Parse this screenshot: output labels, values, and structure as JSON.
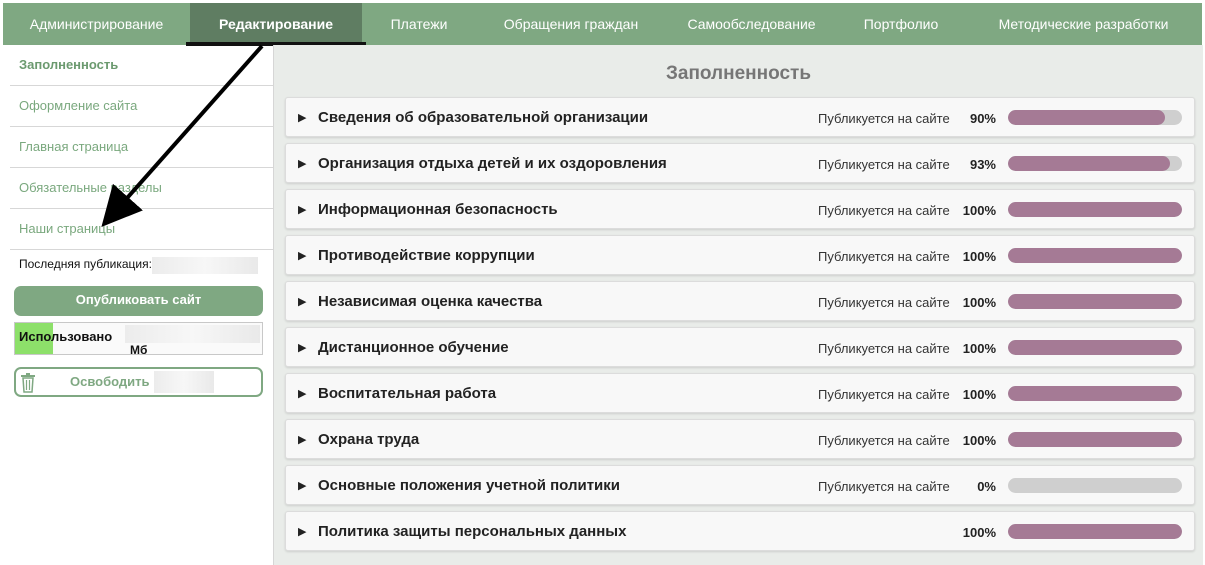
{
  "nav": {
    "items": [
      {
        "label": "Администрирование",
        "active": false
      },
      {
        "label": "Редактирование",
        "active": true
      },
      {
        "label": "Платежи",
        "active": false
      },
      {
        "label": "Обращения граждан",
        "active": false
      },
      {
        "label": "Самообследование",
        "active": false
      },
      {
        "label": "Портфолио",
        "active": false
      },
      {
        "label": "Методические разработки",
        "active": false
      }
    ]
  },
  "sidebar": {
    "items": [
      {
        "label": "Заполненность",
        "active": true
      },
      {
        "label": "Оформление сайта",
        "active": false
      },
      {
        "label": "Главная страница",
        "active": false
      },
      {
        "label": "Обязательные разделы",
        "active": false
      },
      {
        "label": "Наши страницы",
        "active": false
      }
    ],
    "last_publication_label": "Последняя публикация:",
    "publish_button": "Опубликовать сайт",
    "usage_label": "Использовано",
    "usage_unit": "Мб",
    "free_button": "Освободить"
  },
  "main": {
    "title": "Заполненность",
    "publish_text": "Публикуется на сайте",
    "sections": [
      {
        "title": "Сведения об образовательной организации",
        "published": true,
        "percent_text": "90%",
        "fill": 0.9
      },
      {
        "title": "Организация отдыха детей и их оздоровления",
        "published": true,
        "percent_text": "93%",
        "fill": 0.93
      },
      {
        "title": "Информационная безопасность",
        "published": true,
        "percent_text": "100%",
        "fill": 1.0
      },
      {
        "title": "Противодействие коррупции",
        "published": true,
        "percent_text": "100%",
        "fill": 1.0
      },
      {
        "title": "Независимая оценка качества",
        "published": true,
        "percent_text": "100%",
        "fill": 1.0
      },
      {
        "title": "Дистанционное обучение",
        "published": true,
        "percent_text": "100%",
        "fill": 1.0
      },
      {
        "title": "Воспитательная работа",
        "published": true,
        "percent_text": "100%",
        "fill": 1.0
      },
      {
        "title": "Охрана труда",
        "published": true,
        "percent_text": "100%",
        "fill": 1.0
      },
      {
        "title": "Основные положения учетной политики",
        "published": true,
        "percent_text": "0%",
        "fill": 0.0
      },
      {
        "title": "Политика защиты персональных данных",
        "published": false,
        "percent_text": "100%",
        "fill": 1.0
      }
    ]
  },
  "colors": {
    "nav_bg": "#7fa882",
    "nav_active": "#5f7d62",
    "bar_fill": "#a57a95",
    "bar_track": "#cfcfcf",
    "usage_fill": "#8de06a"
  }
}
